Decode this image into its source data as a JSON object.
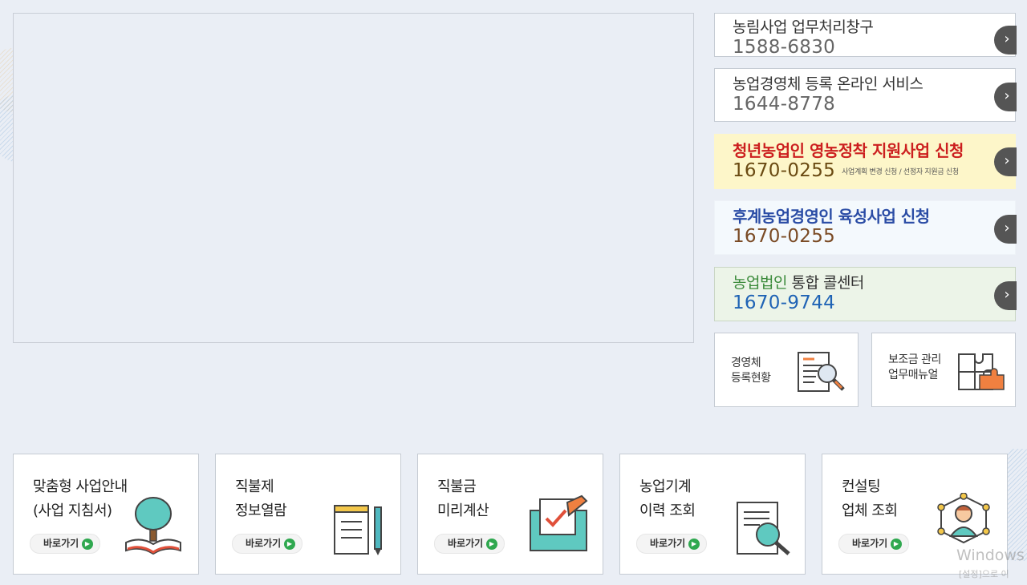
{
  "services": [
    {
      "title": "농림사업 업무처리창구",
      "phone": "1588-6830"
    },
    {
      "title": "농업경영체 등록 온라인 서비스",
      "phone": "1644-8778"
    },
    {
      "title": "청년농업인 영농정착 지원사업 신청",
      "phone": "1670-0255",
      "sub": "사업계획 변경 신청 / 선정자 지원금 신청"
    },
    {
      "title": "후계농업경영인 육성사업 신청",
      "phone": "1670-0255"
    },
    {
      "title_green": "농업법인",
      "title_rest": " 통합 콜센터",
      "phone": "1670-9744"
    }
  ],
  "arrow_glyph": "›",
  "quick": [
    {
      "line1": "경영체",
      "line2": "등록현황",
      "icon": "document-search-icon"
    },
    {
      "line1": "보조금 관리",
      "line2": "업무매뉴얼",
      "icon": "puzzle-icon"
    }
  ],
  "cards": [
    {
      "line1": "맞춤형 사업안내",
      "line2": "(사업 지침서)",
      "icon": "tree-book-icon"
    },
    {
      "line1": "직불제",
      "line2": "정보열람",
      "icon": "notepad-pen-icon"
    },
    {
      "line1": "직불금",
      "line2": "미리계산",
      "icon": "calculator-check-icon"
    },
    {
      "line1": "농업기계",
      "line2": "이력 조회",
      "icon": "magnifier-document-icon"
    },
    {
      "line1": "컨설팅",
      "line2": "업체 조회",
      "icon": "consultant-network-icon"
    }
  ],
  "go_label": "바로가기",
  "go_glyph": "▶",
  "watermark": {
    "line1": "Windows",
    "line2": "[설정]으로 이"
  },
  "colors": {
    "page_bg": "#eaeef5",
    "youth_bg": "#fdf6c9",
    "youth_title": "#cc1f1f",
    "successor_title": "#2a4ca5",
    "corp_bg": "#ecf4e8",
    "corp_phone": "#1f63b5",
    "go_dot": "#2fa84f"
  }
}
